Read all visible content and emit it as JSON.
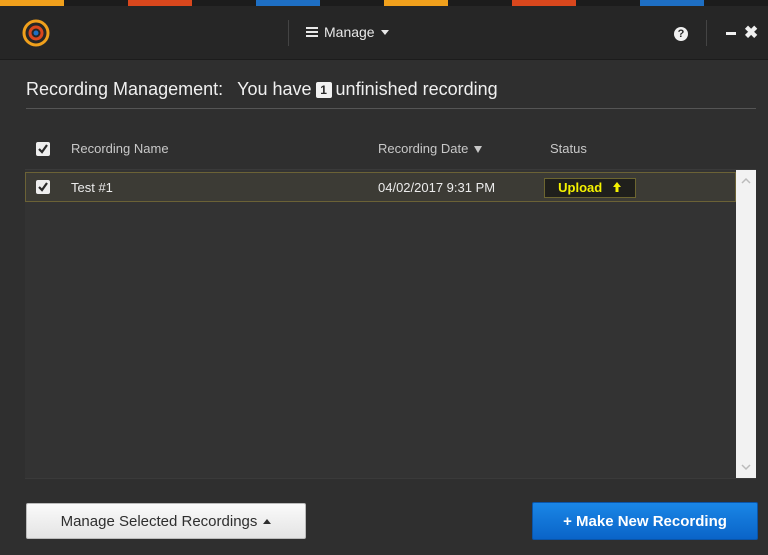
{
  "colors": {
    "accent_blue": "#0a6fd8",
    "upload_yellow": "#f4f200",
    "stripe": [
      "#f0a01c",
      "#1c1c1c",
      "#d9471d",
      "#1c1c1c",
      "#1e6fc4",
      "#1c1c1c",
      "#f0a01c",
      "#1c1c1c",
      "#d9471d",
      "#1c1c1c",
      "#1e6fc4",
      "#1c1c1c"
    ]
  },
  "titlebar": {
    "logo_icon": "app-logo-icon",
    "manage_label": "Manage",
    "help_label": "?",
    "minimize_label": "–",
    "close_label": "✖"
  },
  "heading": {
    "prefix": "Recording Management:",
    "you_have": "You have",
    "count": "1",
    "suffix": "unfinished recording"
  },
  "table": {
    "columns": {
      "name": "Recording Name",
      "date": "Recording Date",
      "status": "Status"
    },
    "rows": [
      {
        "name": "Test #1",
        "date": "04/02/2017 9:31 PM",
        "status": "Upload"
      }
    ]
  },
  "footer": {
    "manage_selected": "Manage Selected Recordings",
    "make_new": "+ Make New Recording"
  }
}
